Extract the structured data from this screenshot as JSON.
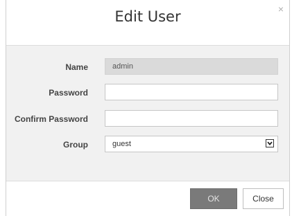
{
  "dialog": {
    "title": "Edit User",
    "close_glyph": "×",
    "close_icon": "close-icon"
  },
  "form": {
    "name": {
      "label": "Name",
      "value": "admin"
    },
    "password": {
      "label": "Password",
      "value": ""
    },
    "confirm_password": {
      "label": "Confirm Password",
      "value": ""
    },
    "group": {
      "label": "Group",
      "value": "guest",
      "icon": "chevron-down-icon"
    }
  },
  "footer": {
    "ok_label": "OK",
    "close_label": "Close"
  },
  "colors": {
    "body_background": "#f1f1f1",
    "ok_button": "#7a7a7a",
    "readonly_field": "#dadada"
  }
}
